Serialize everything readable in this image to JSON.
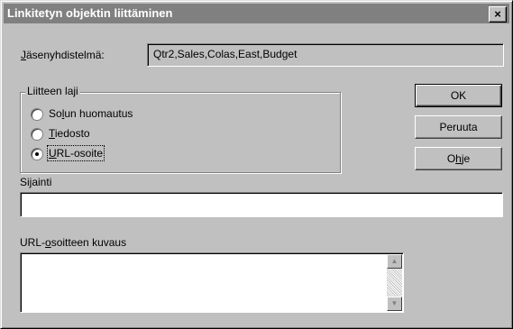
{
  "window": {
    "title": "Linkitetyn objektin liittäminen",
    "close_glyph": "×"
  },
  "member": {
    "label": "Jäsenyhdistelmä:",
    "value": "Qtr2,Sales,Colas,East,Budget"
  },
  "attachment_type": {
    "title": "Liitteen laji",
    "options": [
      {
        "label": "Solun huomautus",
        "selected": false
      },
      {
        "label": "Tiedosto",
        "selected": false
      },
      {
        "label": "URL-osoite",
        "selected": true
      }
    ]
  },
  "buttons": {
    "ok": "OK",
    "cancel": "Peruuta",
    "help": "Ohje"
  },
  "location": {
    "label": "Sijainti",
    "value": ""
  },
  "url_description": {
    "label": "URL-osoitteen kuvaus",
    "value": ""
  },
  "icons": {
    "scroll_up": "scroll-up-arrow",
    "scroll_down": "scroll-down-arrow"
  }
}
